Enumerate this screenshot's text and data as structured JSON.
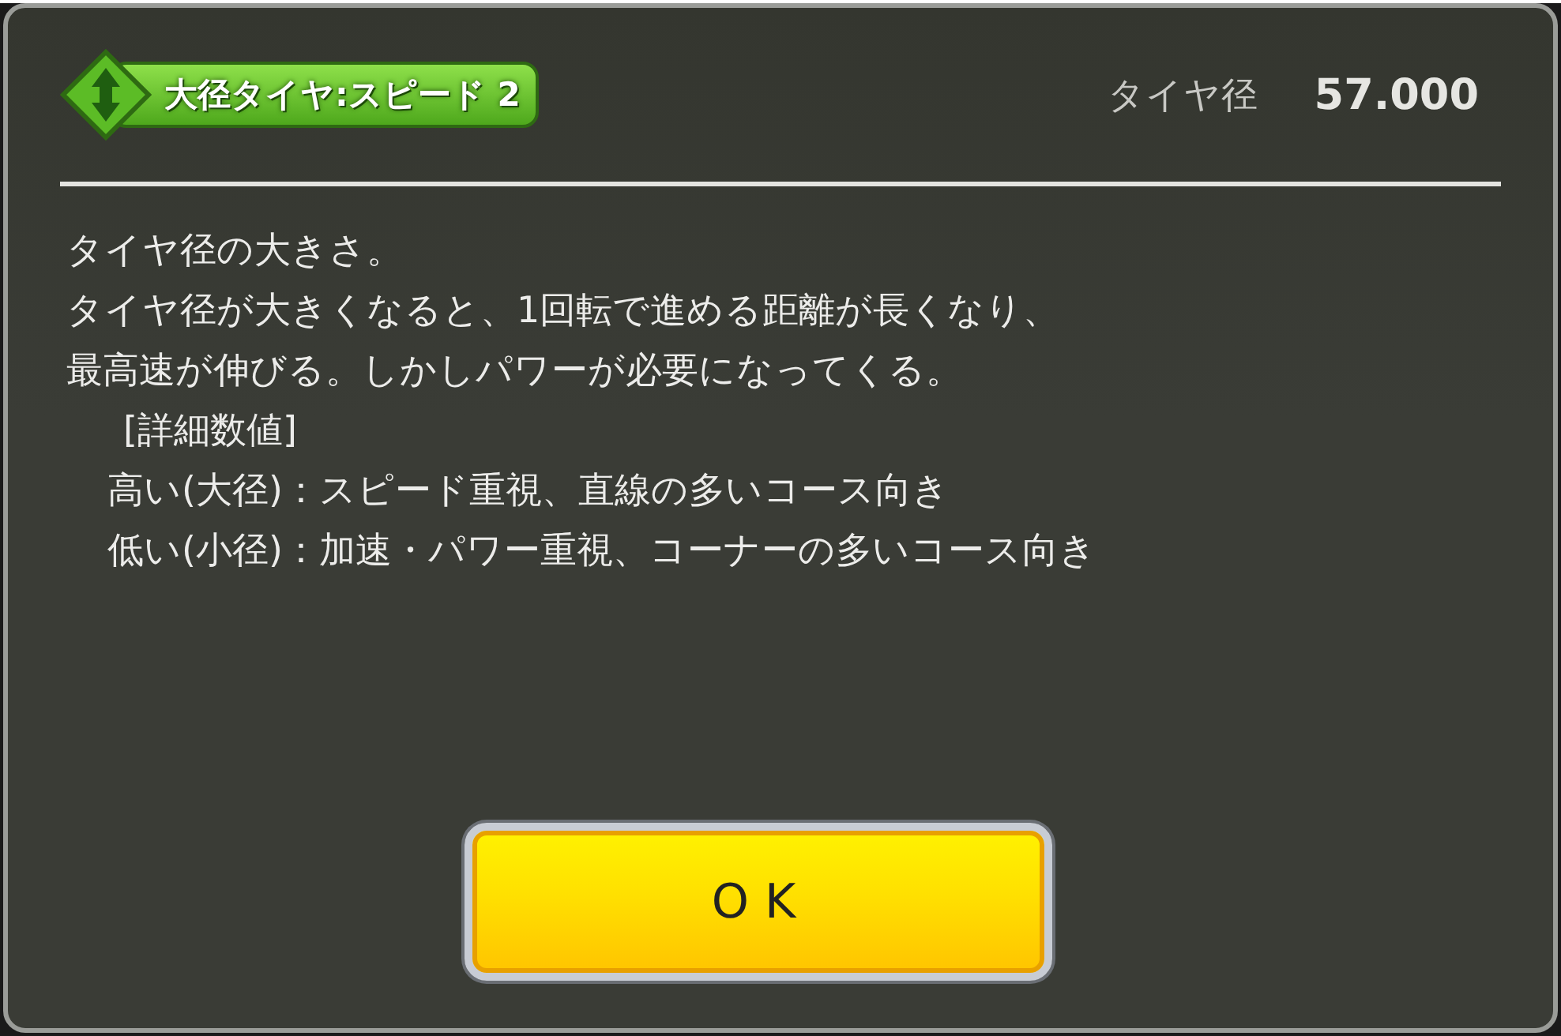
{
  "badge": {
    "label": "大径タイヤ:スピード 2"
  },
  "stat": {
    "label": "タイヤ径",
    "value": "57.000"
  },
  "description": [
    {
      "kind": "text",
      "text": "タイヤ径の大きさ。"
    },
    {
      "kind": "text",
      "text": "タイヤ径が大きくなると、1回転で進める距離が長くなり、"
    },
    {
      "kind": "text",
      "text": "最高速が伸びる。しかしパワーが必要になってくる。"
    },
    {
      "kind": "heading",
      "text": "[詳細数値]"
    },
    {
      "kind": "detail",
      "text": "高い(大径)：スピード重視、直線の多いコース向き"
    },
    {
      "kind": "detail",
      "text": "低い(小径)：加速・パワー重視、コーナーの多いコース向き"
    }
  ],
  "button": {
    "label": "OK"
  }
}
